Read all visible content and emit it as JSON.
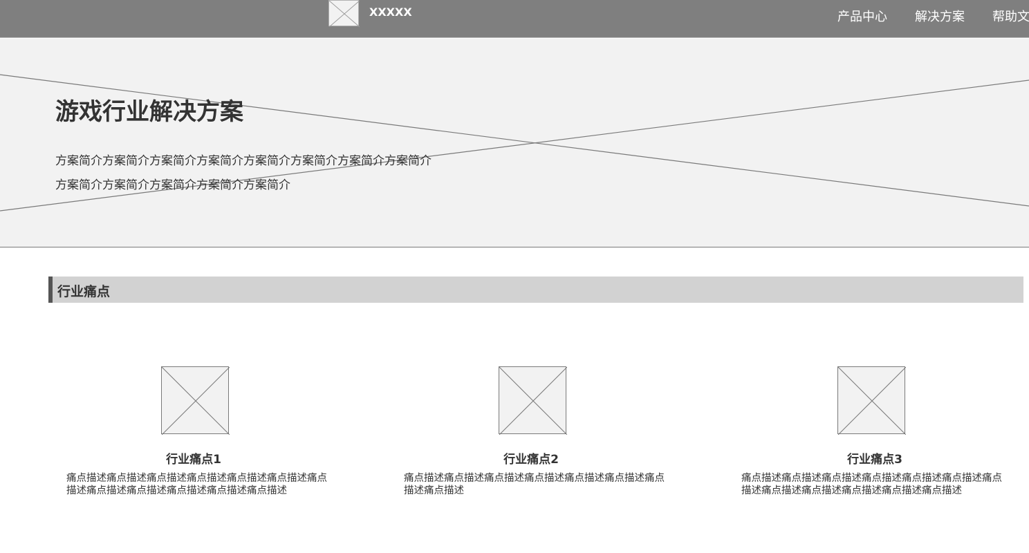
{
  "header": {
    "brand": "XXXXX",
    "nav": [
      "产品中心",
      "解决方案",
      "帮助文档"
    ]
  },
  "hero": {
    "title": "游戏行业解决方案",
    "description": "方案简介方案简介方案简介方案简介方案简介方案简介方案简介方案简介方案简介方案简介方案简介方案简介方案简介"
  },
  "section": {
    "title": "行业痛点"
  },
  "cards": [
    {
      "title": "行业痛点1",
      "desc": "痛点描述痛点描述痛点描述痛点描述痛点描述痛点描述痛点描述痛点描述痛点描述痛点描述痛点描述痛点描述"
    },
    {
      "title": "行业痛点2",
      "desc": "痛点描述痛点描述痛点描述痛点描述痛点描述痛点描述痛点描述痛点描述"
    },
    {
      "title": "行业痛点3",
      "desc": "痛点描述痛点描述痛点描述痛点描述痛点描述痛点描述痛点描述痛点描述痛点描述痛点描述痛点描述痛点描述"
    }
  ],
  "colors": {
    "header_bg": "#7f7f7f",
    "hero_bg": "#f2f2f2",
    "section_bg": "#d2d2d2",
    "accent_bar": "#555555"
  },
  "icons": {
    "logo": "image-placeholder-icon",
    "card_image": "image-placeholder-icon"
  }
}
